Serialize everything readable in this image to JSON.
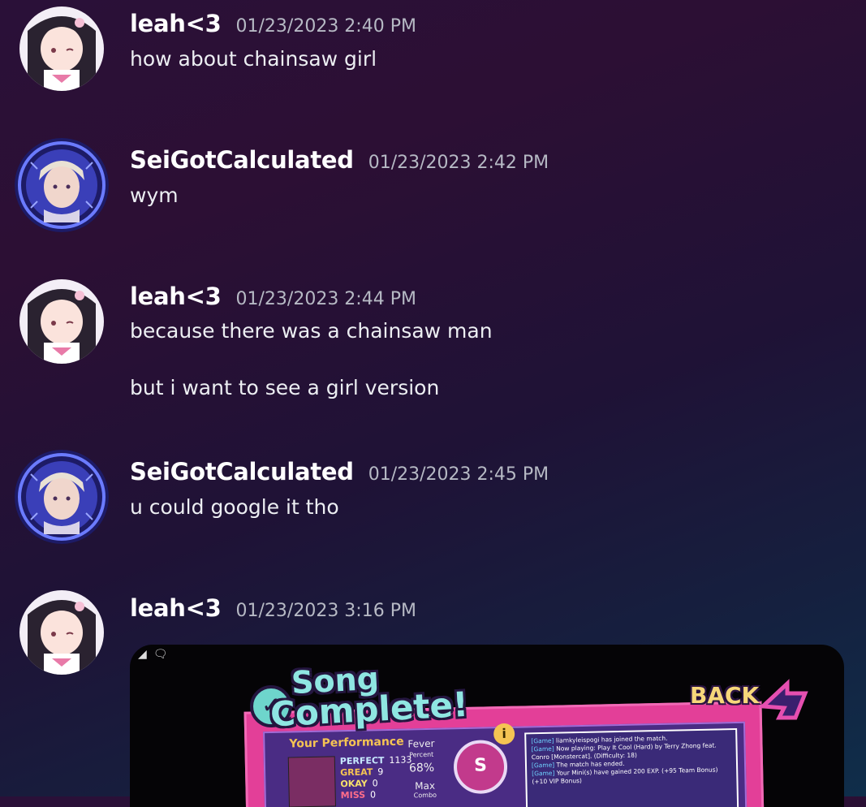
{
  "messages": [
    {
      "author": "leah<3",
      "timestamp": "01/23/2023 2:40 PM",
      "lines": [
        "how about chainsaw girl"
      ]
    },
    {
      "author": "SeiGotCalculated",
      "timestamp": "01/23/2023 2:42 PM",
      "lines": [
        "wym"
      ]
    },
    {
      "author": "leah<3",
      "timestamp": "01/23/2023 2:44 PM",
      "lines": [
        "because there was a chainsaw man",
        "but i want to see a girl version"
      ]
    },
    {
      "author": "SeiGotCalculated",
      "timestamp": "01/23/2023 2:45 PM",
      "lines": [
        "u could google it tho"
      ]
    },
    {
      "author": "leah<3",
      "timestamp": "01/23/2023 3:16 PM",
      "lines": []
    }
  ],
  "embed": {
    "title_line1": "Song",
    "title_line2": "Complete!",
    "back_label": "BACK",
    "performance_label": "Your Performance",
    "stats": [
      {
        "label": "PERFECT",
        "value": "1133"
      },
      {
        "label": "GREAT",
        "value": "9"
      },
      {
        "label": "OKAY",
        "value": "0"
      },
      {
        "label": "MISS",
        "value": "0"
      }
    ],
    "fever_label": "Fever",
    "fever_sub": "Percent",
    "fever_value": "68%",
    "max_label": "Max",
    "max_sub": "Combo",
    "rank": "S",
    "info": "i",
    "log": [
      {
        "tag": "[Game]",
        "text": "liamkyleispogi has joined the match."
      },
      {
        "tag": "[Game]",
        "text": "Now playing: Play It Cool (Hard) by Terry Zhong feat. Conro [Monstercat]. (Difficulty: 18)"
      },
      {
        "tag": "[Game]",
        "text": "The match has ended."
      },
      {
        "tag": "[Game]",
        "text": "Your Mini(s) have gained 200 EXP. (+95 Team Bonus) (+10 VIP Bonus)"
      }
    ]
  },
  "colors": {
    "name": "#ffffff",
    "timestamp": "#b6b9c4",
    "accent_pink": "#e33f98"
  }
}
